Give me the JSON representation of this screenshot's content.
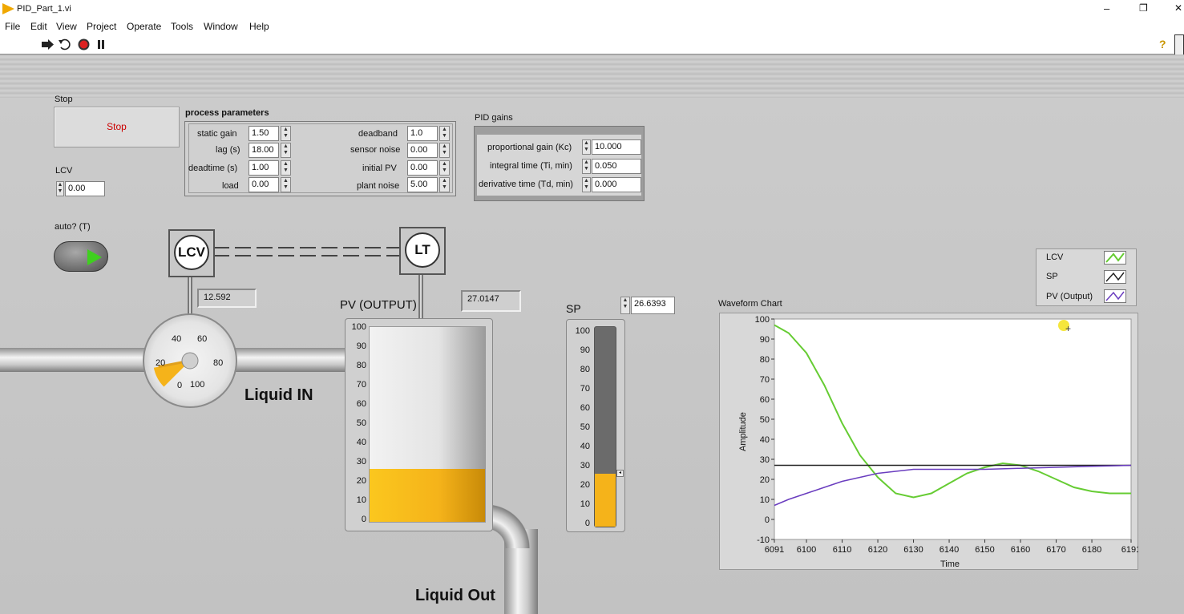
{
  "window": {
    "title": "PID_Part_1.vi",
    "minimize": "–",
    "restore": "❐",
    "close": "✕"
  },
  "menu": [
    "File",
    "Edit",
    "View",
    "Project",
    "Operate",
    "Tools",
    "Window",
    "Help"
  ],
  "toolbar": {
    "run": "run-arrow-icon",
    "run_continuous": "run-continuous-icon",
    "abort": "abort-icon",
    "pause": "pause-icon",
    "help": "?"
  },
  "stop": {
    "caption": "Stop",
    "label": "Stop"
  },
  "process": {
    "title": "process parameters",
    "left": [
      {
        "label": "static gain",
        "value": "1.50"
      },
      {
        "label": "lag (s)",
        "value": "18.00"
      },
      {
        "label": "deadtime (s)",
        "value": "1.00"
      },
      {
        "label": "load",
        "value": "0.00"
      }
    ],
    "right": [
      {
        "label": "deadband",
        "value": "1.0"
      },
      {
        "label": "sensor noise",
        "value": "0.00"
      },
      {
        "label": "initial PV",
        "value": "0.00"
      },
      {
        "label": "plant noise",
        "value": "5.00"
      }
    ]
  },
  "pid": {
    "title": "PID gains",
    "rows": [
      {
        "label": "proportional gain (Kc)",
        "value": "10.000"
      },
      {
        "label": "integral time (Ti, min)",
        "value": "0.050"
      },
      {
        "label": "derivative time (Td, min)",
        "value": "0.000"
      }
    ]
  },
  "lcv_control": {
    "label": "LCV",
    "value": "0.00"
  },
  "auto": {
    "label": "auto? (T)"
  },
  "instruments": {
    "lcv": "LCV",
    "lt": "LT"
  },
  "indicators": {
    "lcv_value": "12.592",
    "pv_value": "27.0147"
  },
  "gauge": {
    "ticks": [
      "0",
      "20",
      "40",
      "60",
      "80",
      "100"
    ],
    "value": 12.592
  },
  "tank": {
    "label": "PV (OUTPUT)",
    "ticks": [
      "100",
      "90",
      "80",
      "70",
      "60",
      "50",
      "40",
      "30",
      "20",
      "10",
      "0"
    ],
    "level": 27.0147
  },
  "sp": {
    "label": "SP",
    "value": "26.6393",
    "ticks": [
      "100",
      "90",
      "80",
      "70",
      "60",
      "50",
      "40",
      "30",
      "20",
      "10",
      "0"
    ],
    "level": 26.6393
  },
  "labels": {
    "liquid_in": "Liquid IN",
    "liquid_out": "Liquid Out"
  },
  "colors": {
    "lcv": "#66cc33",
    "sp": "#222222",
    "pv": "#6a3dbf",
    "fluid": "#f5b31a",
    "panel": "#c6c6c6"
  },
  "chart_data": {
    "type": "line",
    "title": "Waveform Chart",
    "xlabel": "Time",
    "ylabel": "Amplitude",
    "xlim": [
      6091,
      6191
    ],
    "ylim": [
      -10,
      100
    ],
    "xticks": [
      "6091",
      "6100",
      "6110",
      "6120",
      "6130",
      "6140",
      "6150",
      "6160",
      "6170",
      "6180",
      "6191"
    ],
    "yticks": [
      "100",
      "90",
      "80",
      "70",
      "60",
      "50",
      "40",
      "30",
      "20",
      "10",
      "0",
      "-10"
    ],
    "legend": "top-right",
    "series": [
      {
        "name": "LCV",
        "color": "#66cc33",
        "x": [
          6091,
          6095,
          6100,
          6105,
          6110,
          6115,
          6120,
          6125,
          6130,
          6135,
          6140,
          6145,
          6150,
          6155,
          6160,
          6165,
          6170,
          6175,
          6180,
          6185,
          6191
        ],
        "y": [
          97,
          93,
          83,
          67,
          48,
          32,
          21,
          13,
          11,
          13,
          18,
          23,
          26,
          28,
          27,
          24,
          20,
          16,
          14,
          13,
          13
        ]
      },
      {
        "name": "SP",
        "color": "#222222",
        "x": [
          6091,
          6191
        ],
        "y": [
          27,
          27
        ]
      },
      {
        "name": "PV (Output)",
        "color": "#6a3dbf",
        "x": [
          6091,
          6095,
          6100,
          6105,
          6110,
          6115,
          6120,
          6125,
          6130,
          6140,
          6150,
          6160,
          6170,
          6180,
          6191
        ],
        "y": [
          7,
          10,
          13,
          16,
          19,
          21,
          23,
          24,
          25,
          25,
          25,
          25.5,
          26,
          26.5,
          27
        ]
      }
    ]
  }
}
